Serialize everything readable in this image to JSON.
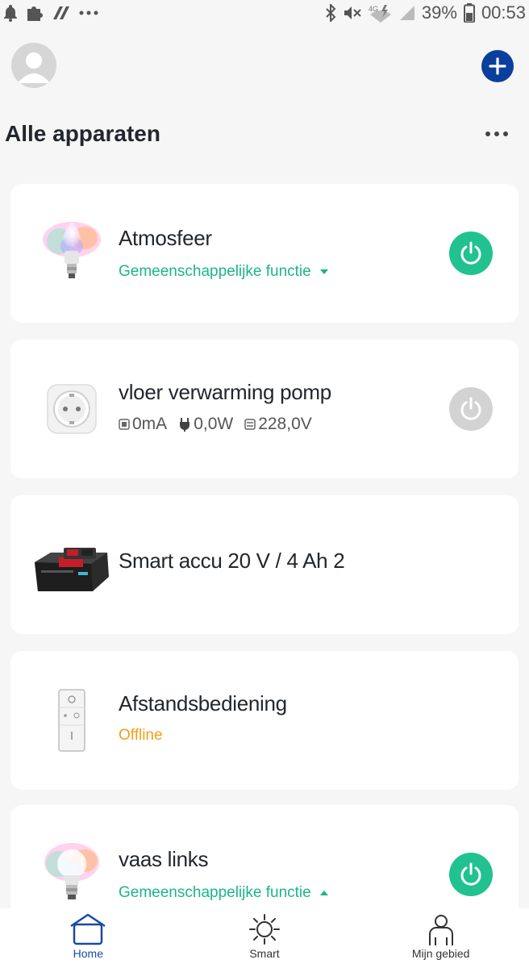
{
  "status_bar": {
    "battery_percent": "39%",
    "time": "00:53",
    "network": "4G"
  },
  "header": {
    "title": "Alle apparaten"
  },
  "devices": [
    {
      "name": "Atmosfeer",
      "subtitle": "Gemeenschappelijke functie",
      "power": "on",
      "image": "color-bulb-candle"
    },
    {
      "name": "vloer verwarming pomp",
      "current": "0mA",
      "power_w": "0,0W",
      "voltage": "228,0V",
      "power": "off",
      "image": "smart-plug"
    },
    {
      "name": "Smart accu 20 V / 4 Ah 2",
      "image": "battery-pack"
    },
    {
      "name": "Afstandsbediening",
      "status": "Offline",
      "image": "remote-control"
    },
    {
      "name": "vaas links",
      "subtitle": "Gemeenschappelijke functie",
      "power": "on",
      "image": "color-bulb"
    }
  ],
  "nav": {
    "home": "Home",
    "smart": "Smart",
    "profile": "Mijn gebied"
  },
  "colors": {
    "accent_blue": "#0b3f9e",
    "power_on": "#21c28f",
    "power_off": "#d3d3d3",
    "link_green": "#1bb589",
    "offline_orange": "#f0a019"
  }
}
